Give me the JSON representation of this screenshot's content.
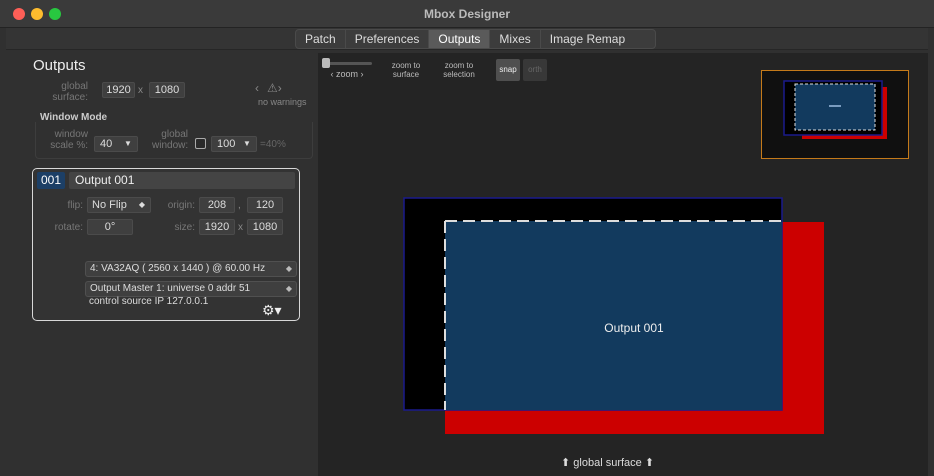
{
  "window": {
    "title": "Mbox Designer"
  },
  "tabs": [
    {
      "label": "Patch"
    },
    {
      "label": "Preferences"
    },
    {
      "label": "Outputs"
    },
    {
      "label": "Mixes"
    },
    {
      "label": "Image Remap"
    }
  ],
  "outputs_panel": {
    "title": "Outputs",
    "global_surface_label": "global surface:",
    "surface_width": "1920",
    "surface_x": "x",
    "surface_height": "1080",
    "nav_icons": [
      "chevron-left-icon",
      "warning-icon",
      "chevron-right-icon"
    ],
    "warnings_text": "no warnings",
    "window_mode_title": "Window Mode",
    "window_scale_label": "window scale %:",
    "window_scale_value": "40",
    "global_window_label": "global window:",
    "global_window_value": "100",
    "global_window_pct": "=40%"
  },
  "output_card": {
    "number": "001",
    "name": "Output 001",
    "flip_label": "flip:",
    "flip_value": "No Flip",
    "origin_label": "origin:",
    "origin_x": "208",
    "origin_sep": ",",
    "origin_y": "120",
    "rotate_label": "rotate:",
    "rotate_value": "0°",
    "size_label": "size:",
    "size_w": "1920",
    "size_x": "x",
    "size_h": "1080",
    "display_select": "4: VA32AQ ( 2560 x 1440 ) @ 60.00 Hz",
    "master_select": "Output Master 1: universe 0 addr 51",
    "control_source": "control source IP 127.0.0.1"
  },
  "canvas": {
    "zoom_label": "zoom",
    "zoom_surface_label": "zoom to surface",
    "zoom_selection_label": "zoom to selection",
    "snap_label": "snap",
    "orth_label": "orth",
    "output_label": "Output 001",
    "global_surface_label": "global surface"
  },
  "colors": {
    "output_fill": "#123a5e",
    "surface_red": "#cc0000",
    "outline_blue": "#1a1a8c",
    "minimap_border": "#c47a1a"
  }
}
